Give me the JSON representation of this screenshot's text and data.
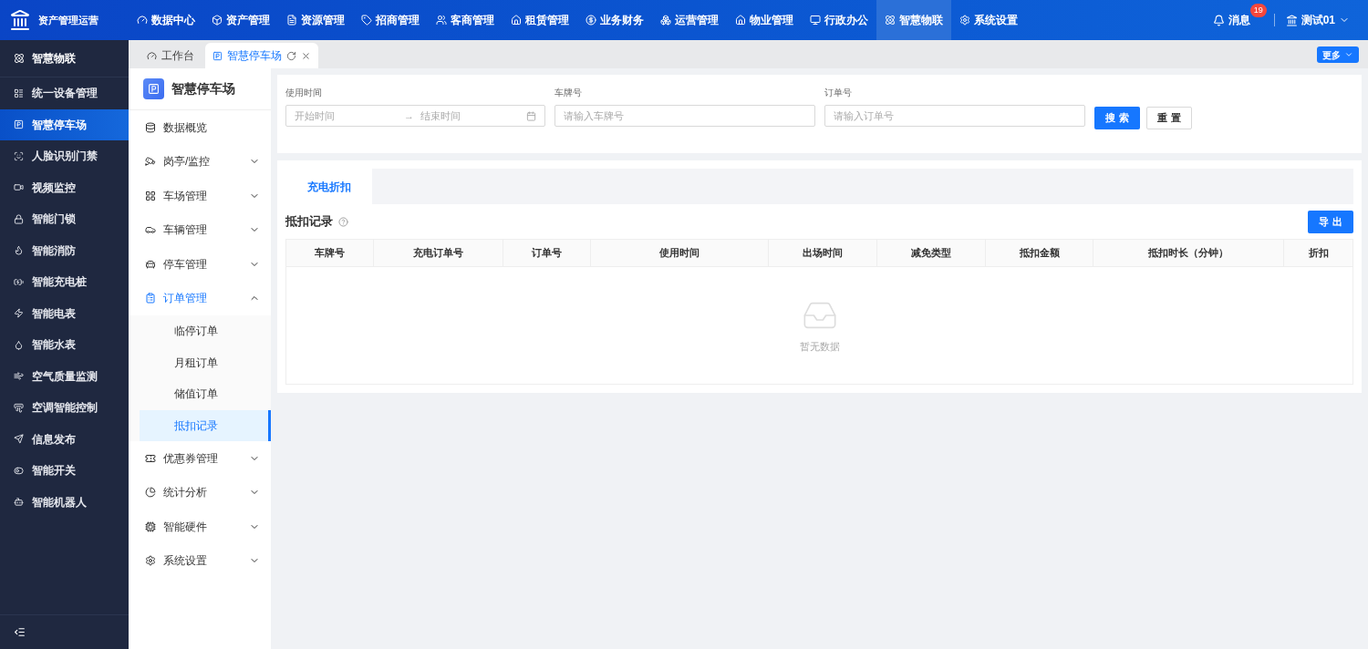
{
  "app_title": "资产管理运营",
  "top_nav": [
    {
      "label": "数据中心",
      "selected": false
    },
    {
      "label": "资产管理",
      "selected": false
    },
    {
      "label": "资源管理",
      "selected": false
    },
    {
      "label": "招商管理",
      "selected": false
    },
    {
      "label": "客商管理",
      "selected": false
    },
    {
      "label": "租赁管理",
      "selected": false
    },
    {
      "label": "业务财务",
      "selected": false
    },
    {
      "label": "运营管理",
      "selected": false
    },
    {
      "label": "物业管理",
      "selected": false
    },
    {
      "label": "行政办公",
      "selected": false
    },
    {
      "label": "智慧物联",
      "selected": true
    },
    {
      "label": "系统设置",
      "selected": false
    }
  ],
  "messages": {
    "label": "消息",
    "badge": "19"
  },
  "user": {
    "name": "测试01"
  },
  "sidebar": {
    "title": "智慧物联",
    "items": [
      {
        "label": "统一设备管理",
        "selected": false
      },
      {
        "label": "智慧停车场",
        "selected": true
      },
      {
        "label": "人脸识别门禁",
        "selected": false
      },
      {
        "label": "视频监控",
        "selected": false
      },
      {
        "label": "智能门锁",
        "selected": false
      },
      {
        "label": "智能消防",
        "selected": false
      },
      {
        "label": "智能充电桩",
        "selected": false
      },
      {
        "label": "智能电表",
        "selected": false
      },
      {
        "label": "智能水表",
        "selected": false
      },
      {
        "label": "空气质量监测",
        "selected": false
      },
      {
        "label": "空调智能控制",
        "selected": false
      },
      {
        "label": "信息发布",
        "selected": false
      },
      {
        "label": "智能开关",
        "selected": false
      },
      {
        "label": "智能机器人",
        "selected": false
      }
    ]
  },
  "page_tabs": [
    {
      "label": "工作台",
      "selected": false
    },
    {
      "label": "智慧停车场",
      "selected": true
    }
  ],
  "more_button": "更多",
  "submenu": {
    "title": "智慧停车场",
    "items": [
      {
        "label": "数据概览",
        "expandable": false,
        "selected": false
      },
      {
        "label": "岗亭/监控",
        "expandable": true,
        "expanded": false,
        "selected": false
      },
      {
        "label": "车场管理",
        "expandable": true,
        "expanded": false,
        "selected": false
      },
      {
        "label": "车辆管理",
        "expandable": true,
        "expanded": false,
        "selected": false
      },
      {
        "label": "停车管理",
        "expandable": true,
        "expanded": false,
        "selected": false
      },
      {
        "label": "订单管理",
        "expandable": true,
        "expanded": true,
        "selected": true,
        "children": [
          {
            "label": "临停订单",
            "selected": false
          },
          {
            "label": "月租订单",
            "selected": false
          },
          {
            "label": "储值订单",
            "selected": false
          },
          {
            "label": "抵扣记录",
            "selected": true
          }
        ]
      },
      {
        "label": "优惠券管理",
        "expandable": true,
        "expanded": false,
        "selected": false
      },
      {
        "label": "统计分析",
        "expandable": true,
        "expanded": false,
        "selected": false
      },
      {
        "label": "智能硬件",
        "expandable": true,
        "expanded": false,
        "selected": false
      },
      {
        "label": "系统设置",
        "expandable": true,
        "expanded": false,
        "selected": false
      }
    ]
  },
  "filters": {
    "time": {
      "label": "使用时间",
      "start_placeholder": "开始时间",
      "separator": "→",
      "end_placeholder": "结束时间"
    },
    "plate": {
      "label": "车牌号",
      "placeholder": "请输入车牌号"
    },
    "order": {
      "label": "订单号",
      "placeholder": "请输入订单号"
    },
    "search_button": "搜 索",
    "reset_button": "重 置"
  },
  "content_tabs": [
    {
      "label": "充电折扣",
      "selected": true
    }
  ],
  "section_title": "抵扣记录",
  "export_button": "导 出",
  "table": {
    "columns": [
      "车牌号",
      "充电订单号",
      "订单号",
      "使用时间",
      "出场时间",
      "减免类型",
      "抵扣金额",
      "抵扣时长（分钟）",
      "折扣"
    ],
    "empty_text": "暂无数据"
  }
}
